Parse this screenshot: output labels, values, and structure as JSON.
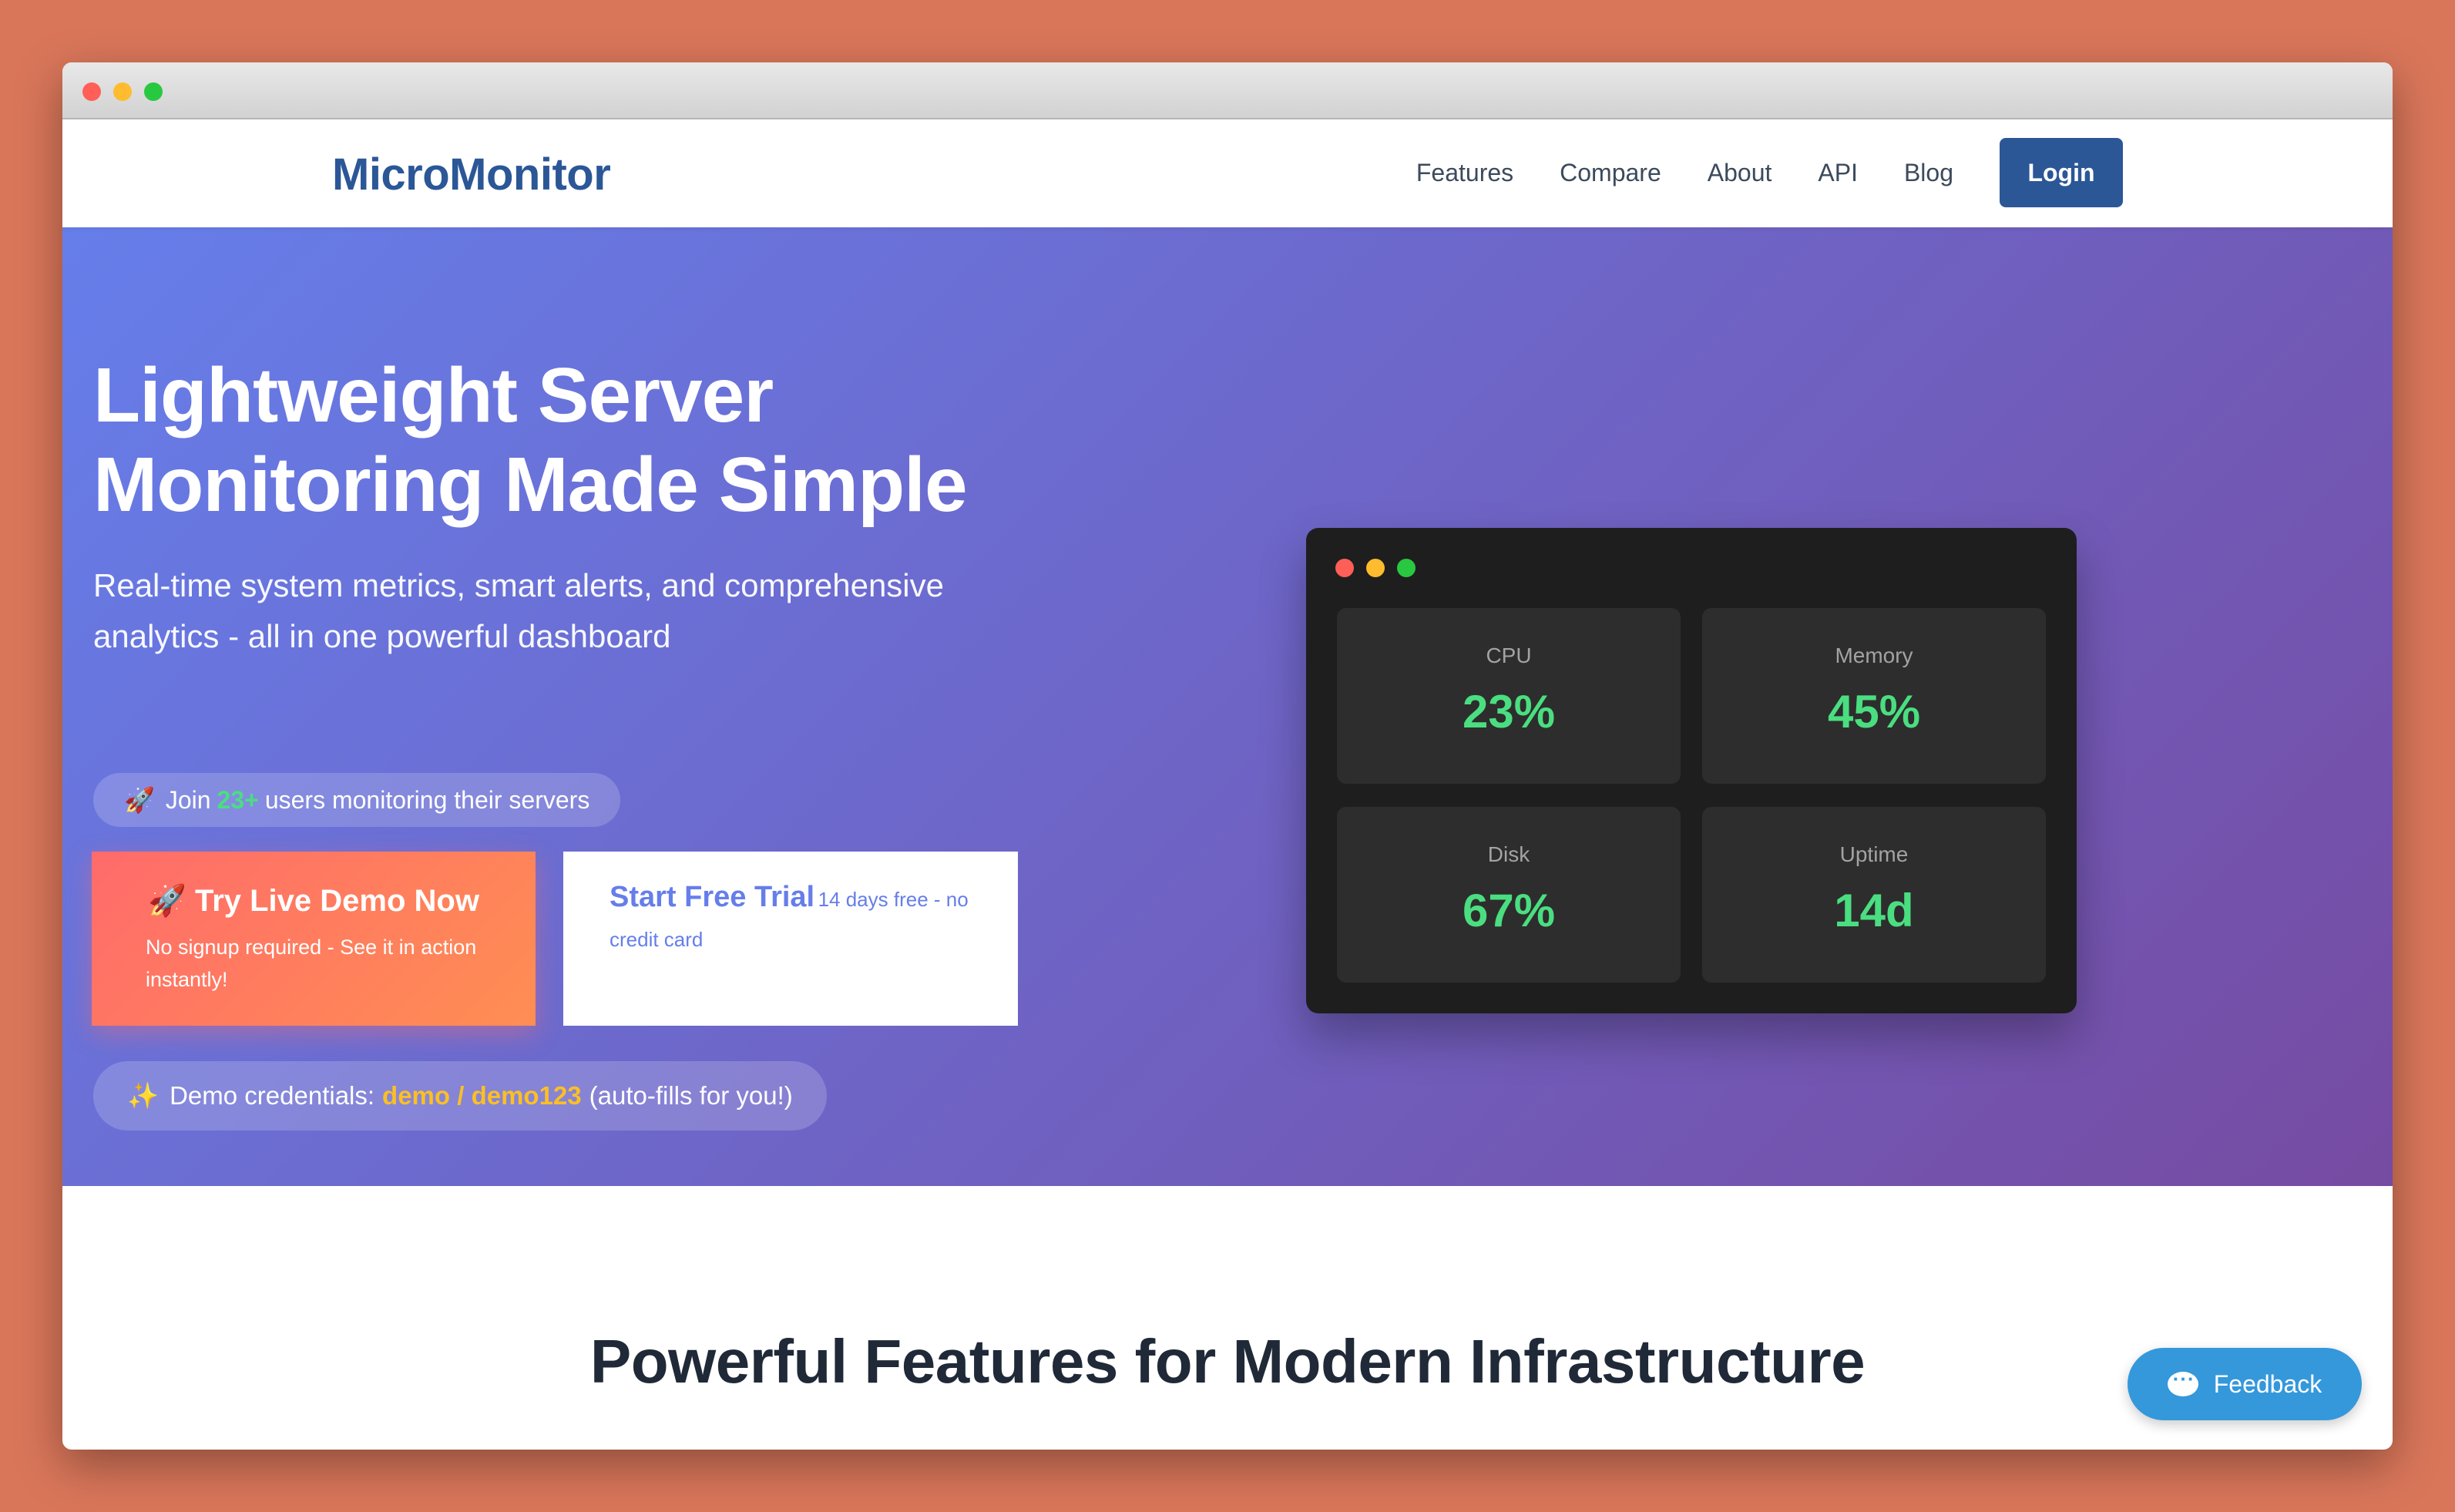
{
  "brand": {
    "name": "MicroMonitor"
  },
  "nav": {
    "links": [
      "Features",
      "Compare",
      "About",
      "API",
      "Blog"
    ],
    "login_label": "Login"
  },
  "hero": {
    "title_line1": "Lightweight Server",
    "title_line2": "Monitoring Made Simple",
    "subtitle": "Real-time system metrics, smart alerts, and comprehensive analytics - all in one powerful dashboard",
    "join": {
      "prefix": "Join",
      "count": "23+",
      "suffix": "users monitoring their servers"
    },
    "demo_button": {
      "title": "Try Live Demo Now",
      "subtitle": "No signup required - See it in action instantly!"
    },
    "trial_button": {
      "title": "Start Free Trial",
      "subtitle": "14 days free - no credit card"
    },
    "credentials": {
      "prefix": "Demo credentials:",
      "value": "demo / demo123",
      "suffix": "(auto-fills for you!)"
    }
  },
  "dashboard": {
    "metrics": [
      {
        "label": "CPU",
        "value": "23%"
      },
      {
        "label": "Memory",
        "value": "45%"
      },
      {
        "label": "Disk",
        "value": "67%"
      },
      {
        "label": "Uptime",
        "value": "14d"
      }
    ]
  },
  "features": {
    "title": "Powerful Features for Modern Infrastructure"
  },
  "feedback": {
    "label": "Feedback"
  },
  "colors": {
    "brand": "#2b5797",
    "accent_green": "#4ade80",
    "accent_yellow": "#fbbf24",
    "hero_gradient_start": "#667eea",
    "hero_gradient_end": "#764ba2",
    "demo_gradient_start": "#ff6b6b",
    "demo_gradient_end": "#ff8e53",
    "feedback_blue": "#3498db"
  }
}
